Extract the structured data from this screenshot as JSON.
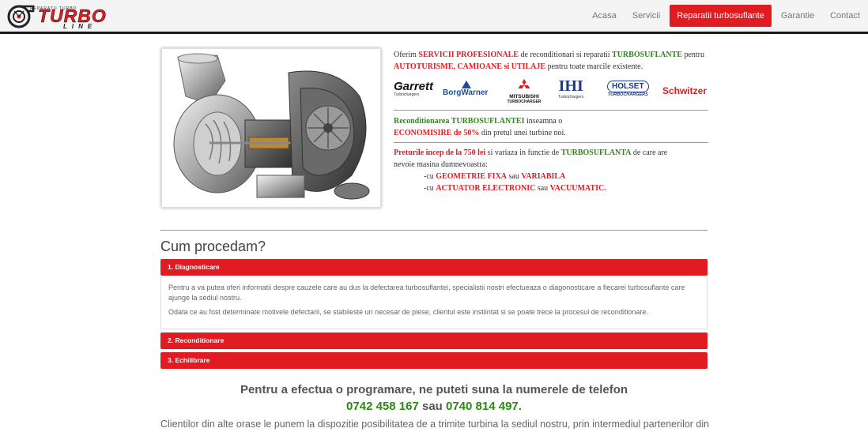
{
  "logo": {
    "small": "REPARATII TURBO",
    "main": "TURBO",
    "sub": "LINE"
  },
  "nav": [
    {
      "label": "Acasa",
      "active": false
    },
    {
      "label": "Servicii",
      "active": false
    },
    {
      "label": "Reparatii turbosuflante",
      "active": true
    },
    {
      "label": "Garantie",
      "active": false
    },
    {
      "label": "Contact",
      "active": false
    }
  ],
  "intro": {
    "p1": "Oferim ",
    "p1_red1": "SERVICII PROFESIONALE",
    "p1_b": " de reconditionari si reparatii ",
    "p1_green1": "TURBOSUFLANTE",
    "p1_c": " pentru ",
    "p1_red2": "AUTOTURISME, CAMIOANE si UTILAJE",
    "p1_d": " pentru toate marcile existente."
  },
  "brands": {
    "garrett": "Garrett",
    "garrett_sub": "Turbochargers",
    "borgwarner": "BorgWarner",
    "mitsubishi": "MITSUBISHI",
    "mitsubishi_sub": "TURBOCHARGER",
    "ihi": "IHI",
    "ihi_sub": "Turbochargers",
    "holset": "HOLSET",
    "holset_sub": "TURBOCHARGERS",
    "schwitzer": "Schwitzer"
  },
  "recon": {
    "green1": "Reconditionarea TURBOSUFLANTEI",
    "a": " inseamna o",
    "red1": "ECONOMISIRE de 50%",
    "b": " din pretul unei turbine noi."
  },
  "prices": {
    "red1": "Preturile incep de la 750 lei",
    "a": " si variaza in functie de ",
    "green1": "TURBOSUFLANTA",
    "b": " de care are",
    "line2": "nevoie masina dumnevoastra:",
    "l3a": "-cu ",
    "l3red1": "GEOMETRIE FIXA",
    "l3b": " sau ",
    "l3red2": "VARIABILA",
    "l4a": "-cu ",
    "l4red1": "ACTUATOR ELECTRONIC",
    "l4b": " sau ",
    "l4red2": "VACUUMATIC."
  },
  "section": {
    "title": "Cum procedam?",
    "items": [
      {
        "label": "1. Diagnosticare"
      },
      {
        "label": "2. Reconditionare"
      },
      {
        "label": "3. Echilibrare"
      }
    ],
    "body_p1": "Pentru a va putea oferi informatii despre cauzele care au dus la defectarea turbosuflantei, specialistii nostri efectueaza o diagonosticare a fiecarei turbosuflante care ajunge la sediul nostru.",
    "body_p2": "Odata ce au fost determinate motivele defectarii, se stabileste un necesar de piese, clientul este instiintat si se poate trece la procesul de reconditionare."
  },
  "cta": {
    "line1": "Pentru a efectua o programare, ne puteti suna la numerele de telefon",
    "phone1": "0742 458 167",
    "and": " sau ",
    "phone2": "0740 814 497",
    "end": "."
  },
  "footer_text": "Clientilor din alte orase le punem la dispozitie posibilitatea de a trimite turbina la sediul nostru, prin intermediul partenerilor din",
  "colors": {
    "accent": "#e11b22",
    "green": "#2b8a14",
    "nav_bg": "#f4f4f4"
  }
}
